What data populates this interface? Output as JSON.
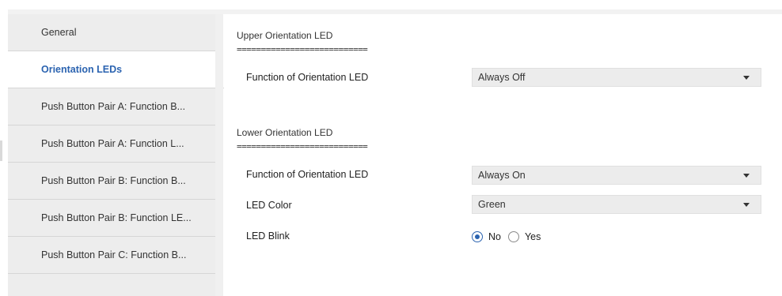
{
  "sidebar": {
    "items": [
      {
        "label": "General",
        "active": false
      },
      {
        "label": "Orientation LEDs",
        "active": true
      },
      {
        "label": "Push Button Pair A: Function B...",
        "active": false
      },
      {
        "label": "Push Button Pair A: Function L...",
        "active": false
      },
      {
        "label": "Push Button Pair B: Function B...",
        "active": false
      },
      {
        "label": "Push Button Pair B: Function LE...",
        "active": false
      },
      {
        "label": "Push Button Pair C: Function B...",
        "active": false
      }
    ]
  },
  "upper": {
    "title": "Upper Orientation LED",
    "separator": "===========================",
    "function_label": "Function of Orientation LED",
    "function_value": "Always Off"
  },
  "lower": {
    "title": "Lower Orientation LED",
    "separator": "===========================",
    "function_label": "Function of Orientation LED",
    "function_value": "Always On",
    "color_label": "LED Color",
    "color_value": "Green",
    "blink_label": "LED Blink",
    "blink_options": [
      "No",
      "Yes"
    ],
    "blink_selected": "No"
  },
  "colors": {
    "accent": "#2b63b0",
    "sidebar_bg": "#ededed",
    "select_bg": "#ececec"
  }
}
